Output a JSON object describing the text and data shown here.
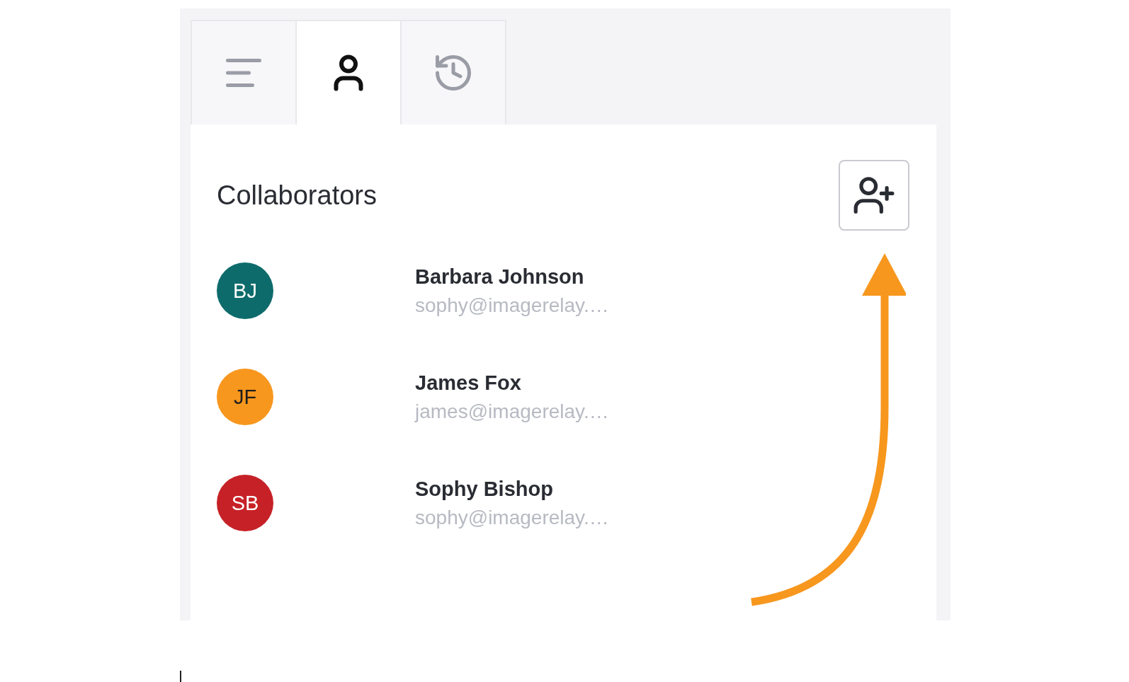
{
  "tabs": [
    {
      "kind": "menu",
      "selected": false
    },
    {
      "kind": "user",
      "selected": true
    },
    {
      "kind": "history",
      "selected": false
    }
  ],
  "collaborators": {
    "title": "Collaborators",
    "people": [
      {
        "initials": "BJ",
        "color": "#0e6b6b",
        "name": "Barbara Johnson",
        "email": "sophy@imagerelay.…"
      },
      {
        "initials": "JF",
        "color": "#f7971e",
        "name": "James Fox",
        "email": "james@imagerelay.…"
      },
      {
        "initials": "SB",
        "color": "#c62127",
        "name": "Sophy Bishop",
        "email": "sophy@imagerelay.…"
      }
    ]
  }
}
